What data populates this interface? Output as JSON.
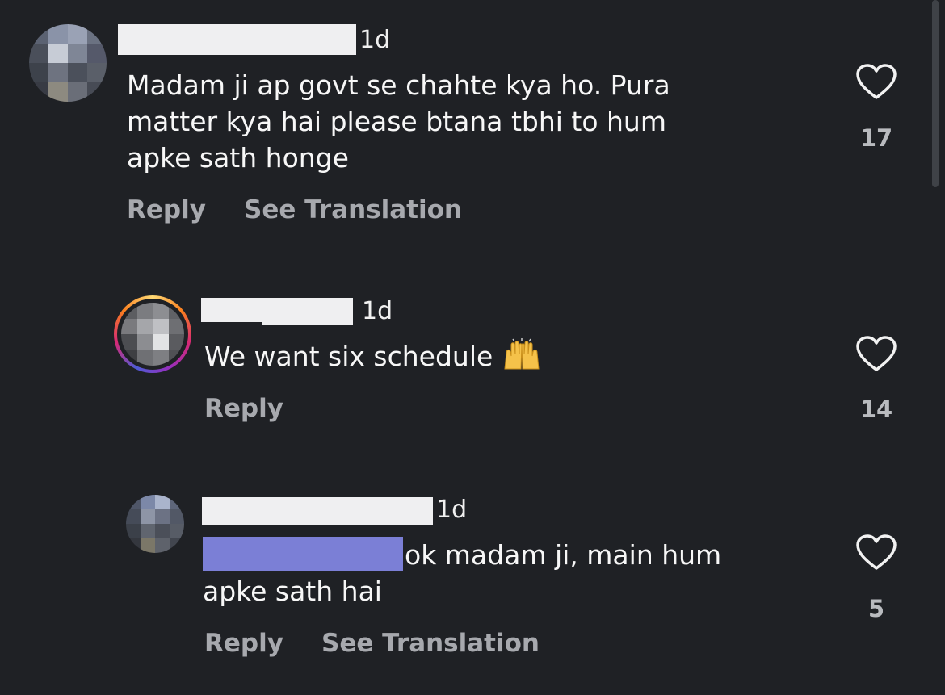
{
  "comments": [
    {
      "time": "1d",
      "lines": [
        "Madam ji ap govt se chahte kya ho. Pura",
        "matter kya hai please btana tbhi to hum",
        "apke sath honge"
      ],
      "reply": "Reply",
      "translate": "See Translation",
      "likes": "17"
    },
    {
      "time": "1d",
      "text": "We want six schedule",
      "emoji": "raising-hands-emoji",
      "reply": "Reply",
      "likes": "14"
    },
    {
      "time": "1d",
      "line1": "ok madam ji, main hum",
      "line2": "apke sath hai",
      "reply": "Reply",
      "translate": "See Translation",
      "likes": "5"
    }
  ],
  "colors": {
    "background": "#1f2125",
    "text": "#f7f7f7",
    "muted": "#a7a9ae",
    "mention_highlight": "#7b7fd6"
  }
}
